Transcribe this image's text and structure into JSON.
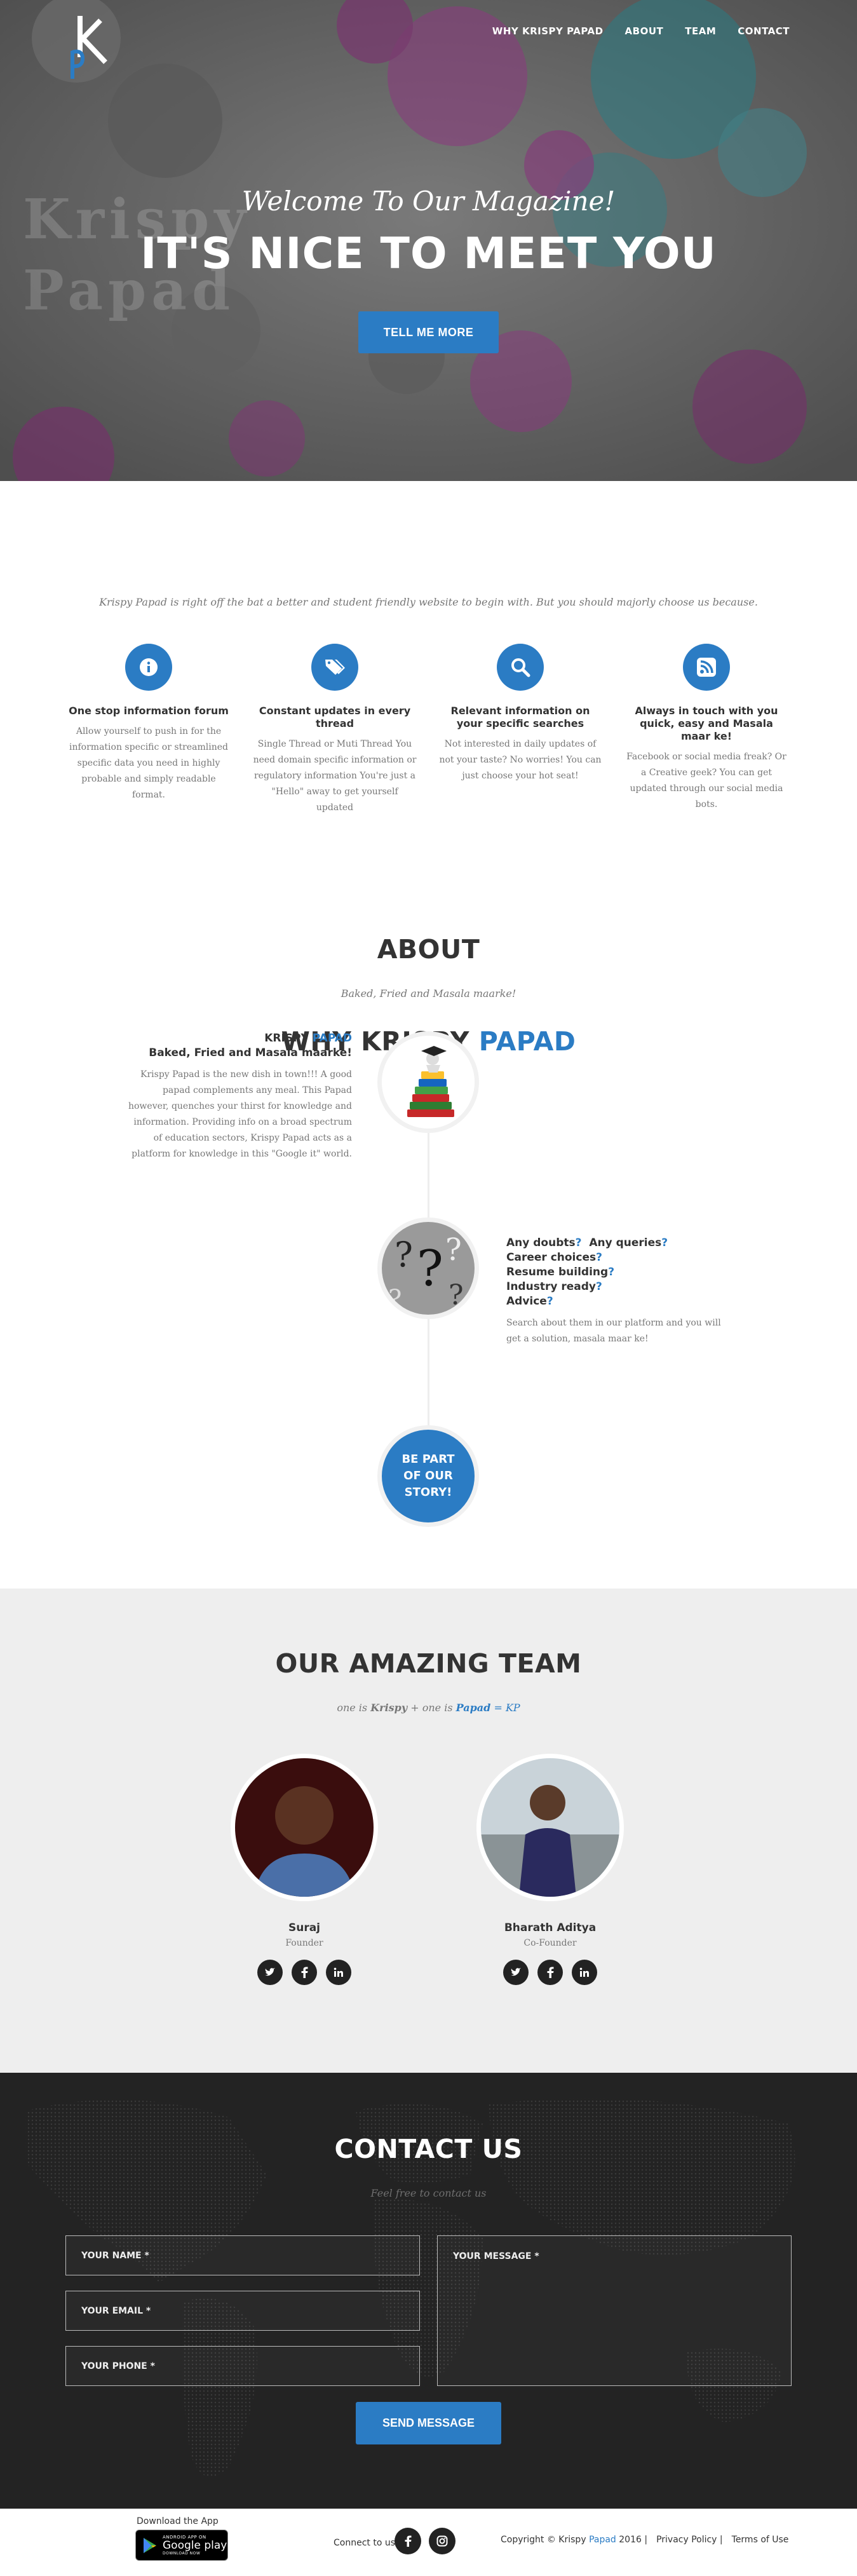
{
  "nav": {
    "items": [
      "WHY KRISPY PAPAD",
      "ABOUT",
      "TEAM",
      "CONTACT"
    ]
  },
  "hero": {
    "watermark_line1": "Krispy",
    "watermark_line2": "Papad",
    "subtitle": "Welcome To Our Magazine!",
    "title": "IT'S NICE TO MEET YOU",
    "button": "TELL ME MORE"
  },
  "why": {
    "title_part1": "WHY KRISPY",
    "title_part2": "PAPAD",
    "subtitle": "Krispy Papad is right off the bat a better and student friendly website to begin with. But you should majorly choose us because.",
    "features": [
      {
        "icon": "info-icon",
        "title": "One stop information forum",
        "text": "Allow yourself to push in for the information specific or streamlined specific data you need in highly probable and simply readable format."
      },
      {
        "icon": "tags-icon",
        "title": "Constant updates in every thread",
        "text": "Single Thread or Muti Thread You need domain specific information or regulatory information You're just a \"Hello\" away to get yourself updated"
      },
      {
        "icon": "search-icon",
        "title": "Relevant information on your specific searches",
        "text": "Not interested in daily updates of not your taste? No worries! You can just choose your hot seat!"
      },
      {
        "icon": "rss-icon",
        "title": "Always in touch with you quick, easy and Masala maar ke!",
        "text": "Facebook or social media freak? Or a Creative geek? You can get updated through our social media bots."
      }
    ]
  },
  "about": {
    "title": "ABOUT",
    "subtitle": "Baked, Fried and Masala maarke!",
    "item1": {
      "brand1": "KRISPY",
      "brand2": "PAPAD",
      "heading": "Baked, Fried and Masala maarke!",
      "text": "Krispy Papad is the new dish in town!!! A good papad complements any meal. This Papad however, quenches your thirst for knowledge and information. Providing info on a broad spectrum of education sectors, Krispy Papad acts as a platform for knowledge in this \"Google it\" world."
    },
    "item2": {
      "q1": "Any doubts",
      "q2": "Any queries",
      "q3": "Career choices",
      "q4": "Resume building",
      "q5": "Industry ready",
      "q6": "Advice",
      "qmark": "?",
      "text": "Search about them in our platform and you will get a solution, masala maar ke!"
    },
    "story_line1": "BE PART",
    "story_line2": "OF OUR",
    "story_line3": "STORY!"
  },
  "team": {
    "title": "OUR AMAZING TEAM",
    "sub_a": "one is",
    "sub_b": "Krispy",
    "sub_c": "+ one is",
    "sub_d": "Papad",
    "sub_e": "= KP",
    "members": [
      {
        "name": "Suraj",
        "role": "Founder"
      },
      {
        "name": "Bharath Aditya",
        "role": "Co-Founder"
      }
    ]
  },
  "contact": {
    "title": "CONTACT US",
    "subtitle": "Feel free to contact us",
    "name_placeholder": "YOUR NAME *",
    "email_placeholder": "YOUR EMAIL *",
    "phone_placeholder": "YOUR PHONE *",
    "message_placeholder": "YOUR MESSAGE *",
    "button": "SEND MESSAGE"
  },
  "footer": {
    "download_label": "Download the App",
    "gplay_top": "ANDROID APP ON",
    "gplay_main": "Google play",
    "gplay_bottom": "DOWNLOAD NOW",
    "connect_label": "Connect to us",
    "copyright_a": "Copyright © Krispy",
    "copyright_b": "Papad",
    "copyright_c": "2016 |",
    "privacy": "Privacy Policy |",
    "terms": "Terms of Use"
  }
}
